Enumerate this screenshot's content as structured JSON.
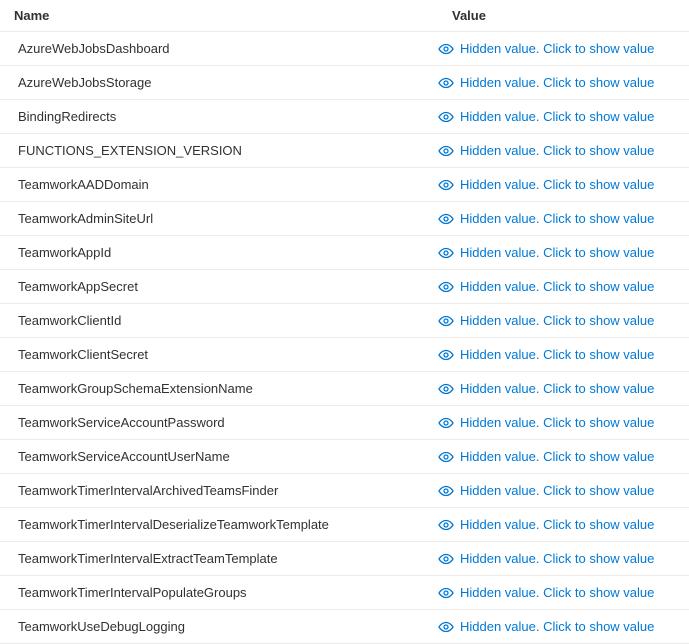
{
  "headers": {
    "name": "Name",
    "value": "Value"
  },
  "hidden_value_label": "Hidden value. Click to show value",
  "rows": [
    {
      "name": "AzureWebJobsDashboard"
    },
    {
      "name": "AzureWebJobsStorage"
    },
    {
      "name": "BindingRedirects"
    },
    {
      "name": "FUNCTIONS_EXTENSION_VERSION"
    },
    {
      "name": "TeamworkAADDomain"
    },
    {
      "name": "TeamworkAdminSiteUrl"
    },
    {
      "name": "TeamworkAppId"
    },
    {
      "name": "TeamworkAppSecret"
    },
    {
      "name": "TeamworkClientId"
    },
    {
      "name": "TeamworkClientSecret"
    },
    {
      "name": "TeamworkGroupSchemaExtensionName"
    },
    {
      "name": "TeamworkServiceAccountPassword"
    },
    {
      "name": "TeamworkServiceAccountUserName"
    },
    {
      "name": "TeamworkTimerIntervalArchivedTeamsFinder"
    },
    {
      "name": "TeamworkTimerIntervalDeserializeTeamworkTemplate"
    },
    {
      "name": "TeamworkTimerIntervalExtractTeamTemplate"
    },
    {
      "name": "TeamworkTimerIntervalPopulateGroups"
    },
    {
      "name": "TeamworkUseDebugLogging"
    }
  ]
}
